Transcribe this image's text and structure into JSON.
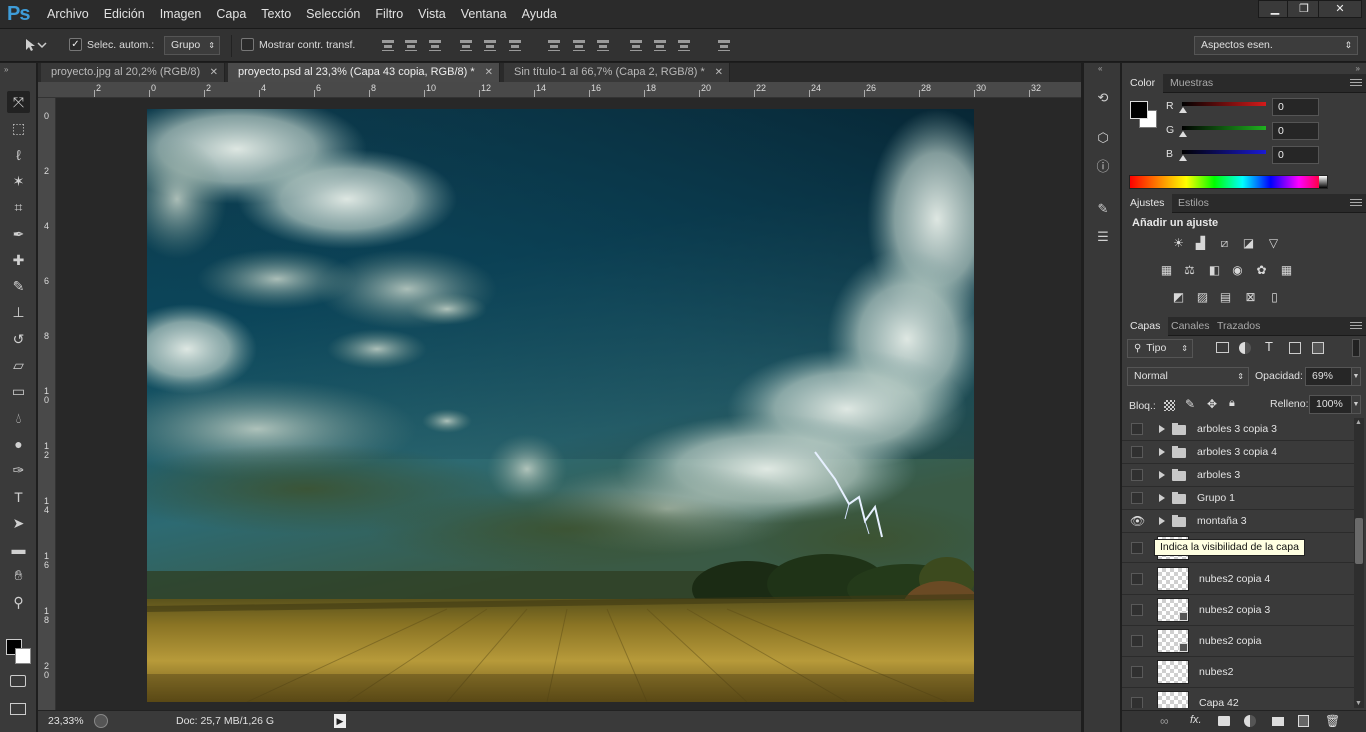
{
  "app": {
    "logo": "Ps"
  },
  "menu": [
    "Archivo",
    "Edición",
    "Imagen",
    "Capa",
    "Texto",
    "Selección",
    "Filtro",
    "Vista",
    "Ventana",
    "Ayuda"
  ],
  "window_controls": {
    "minimize": "▁",
    "restore": "❐",
    "close": "✕"
  },
  "options": {
    "auto_select_label": "Selec. autom.:",
    "auto_select_checked": true,
    "auto_select_target": "Grupo",
    "transform_label": "Mostrar contr. transf.",
    "transform_checked": false,
    "workspace": "Aspectos esen."
  },
  "doc_tabs": [
    {
      "label": "proyecto.jpg al 20,2% (RGB/8)",
      "active": false
    },
    {
      "label": "proyecto.psd al 23,3% (Capa 43 copia, RGB/8) *",
      "active": true
    },
    {
      "label": "Sin título-1 al 66,7% (Capa 2, RGB/8) *",
      "active": false
    }
  ],
  "ruler_top": [
    "2",
    "0",
    "2",
    "4",
    "6",
    "8",
    "10",
    "12",
    "14",
    "16",
    "18",
    "20",
    "22",
    "24",
    "26",
    "28",
    "30",
    "32"
  ],
  "ruler_left": [
    "0",
    "2",
    "4",
    "6",
    "8",
    "10",
    "12",
    "14",
    "16",
    "18",
    "20"
  ],
  "status": {
    "zoom": "23,33%",
    "doc": "Doc: 25,7 MB/1,26 G"
  },
  "tools": [
    "move-tool",
    "marquee-tool",
    "lasso-tool",
    "magic-wand-tool",
    "crop-tool",
    "eyedropper-tool",
    "healing-tool",
    "brush-tool",
    "stamp-tool",
    "history-brush-tool",
    "eraser-tool",
    "gradient-tool",
    "blur-tool",
    "dodge-tool",
    "pen-tool",
    "type-tool",
    "path-select-tool",
    "shape-tool",
    "hand-tool",
    "zoom-tool"
  ],
  "color_panel": {
    "tabs": [
      "Color",
      "Muestras"
    ],
    "channels": [
      {
        "label": "R",
        "value": "0",
        "color": "#d41a1a"
      },
      {
        "label": "G",
        "value": "0",
        "color": "#1fb11f"
      },
      {
        "label": "B",
        "value": "0",
        "color": "#1a1ad4"
      }
    ],
    "foreground": "#000000",
    "background": "#ffffff"
  },
  "adjust_panel": {
    "tabs": [
      "Ajustes",
      "Estilos"
    ],
    "heading": "Añadir un ajuste"
  },
  "layers_panel": {
    "tabs": [
      "Capas",
      "Canales",
      "Trazados"
    ],
    "filter": "Tipo",
    "blend_mode": "Normal",
    "opacity_label": "Opacidad:",
    "opacity": "69%",
    "lock_label": "Bloq.:",
    "fill_label": "Relleno:",
    "fill": "100%",
    "tooltip": "Indica la visibilidad de la capa",
    "groups": [
      {
        "name": "arboles 3 copia 3",
        "visible": false
      },
      {
        "name": "arboles 3 copia 4",
        "visible": false
      },
      {
        "name": "arboles 3",
        "visible": false
      },
      {
        "name": "Grupo 1",
        "visible": false
      },
      {
        "name": "montaña 3",
        "visible": true
      }
    ],
    "layers": [
      {
        "name": "nubes2 copia 4",
        "smart": false
      },
      {
        "name": "nubes2 copia 3",
        "smart": true
      },
      {
        "name": "nubes2 copia",
        "smart": true
      },
      {
        "name": "nubes2",
        "smart": false
      },
      {
        "name": "Capa 42",
        "smart": false
      }
    ]
  }
}
